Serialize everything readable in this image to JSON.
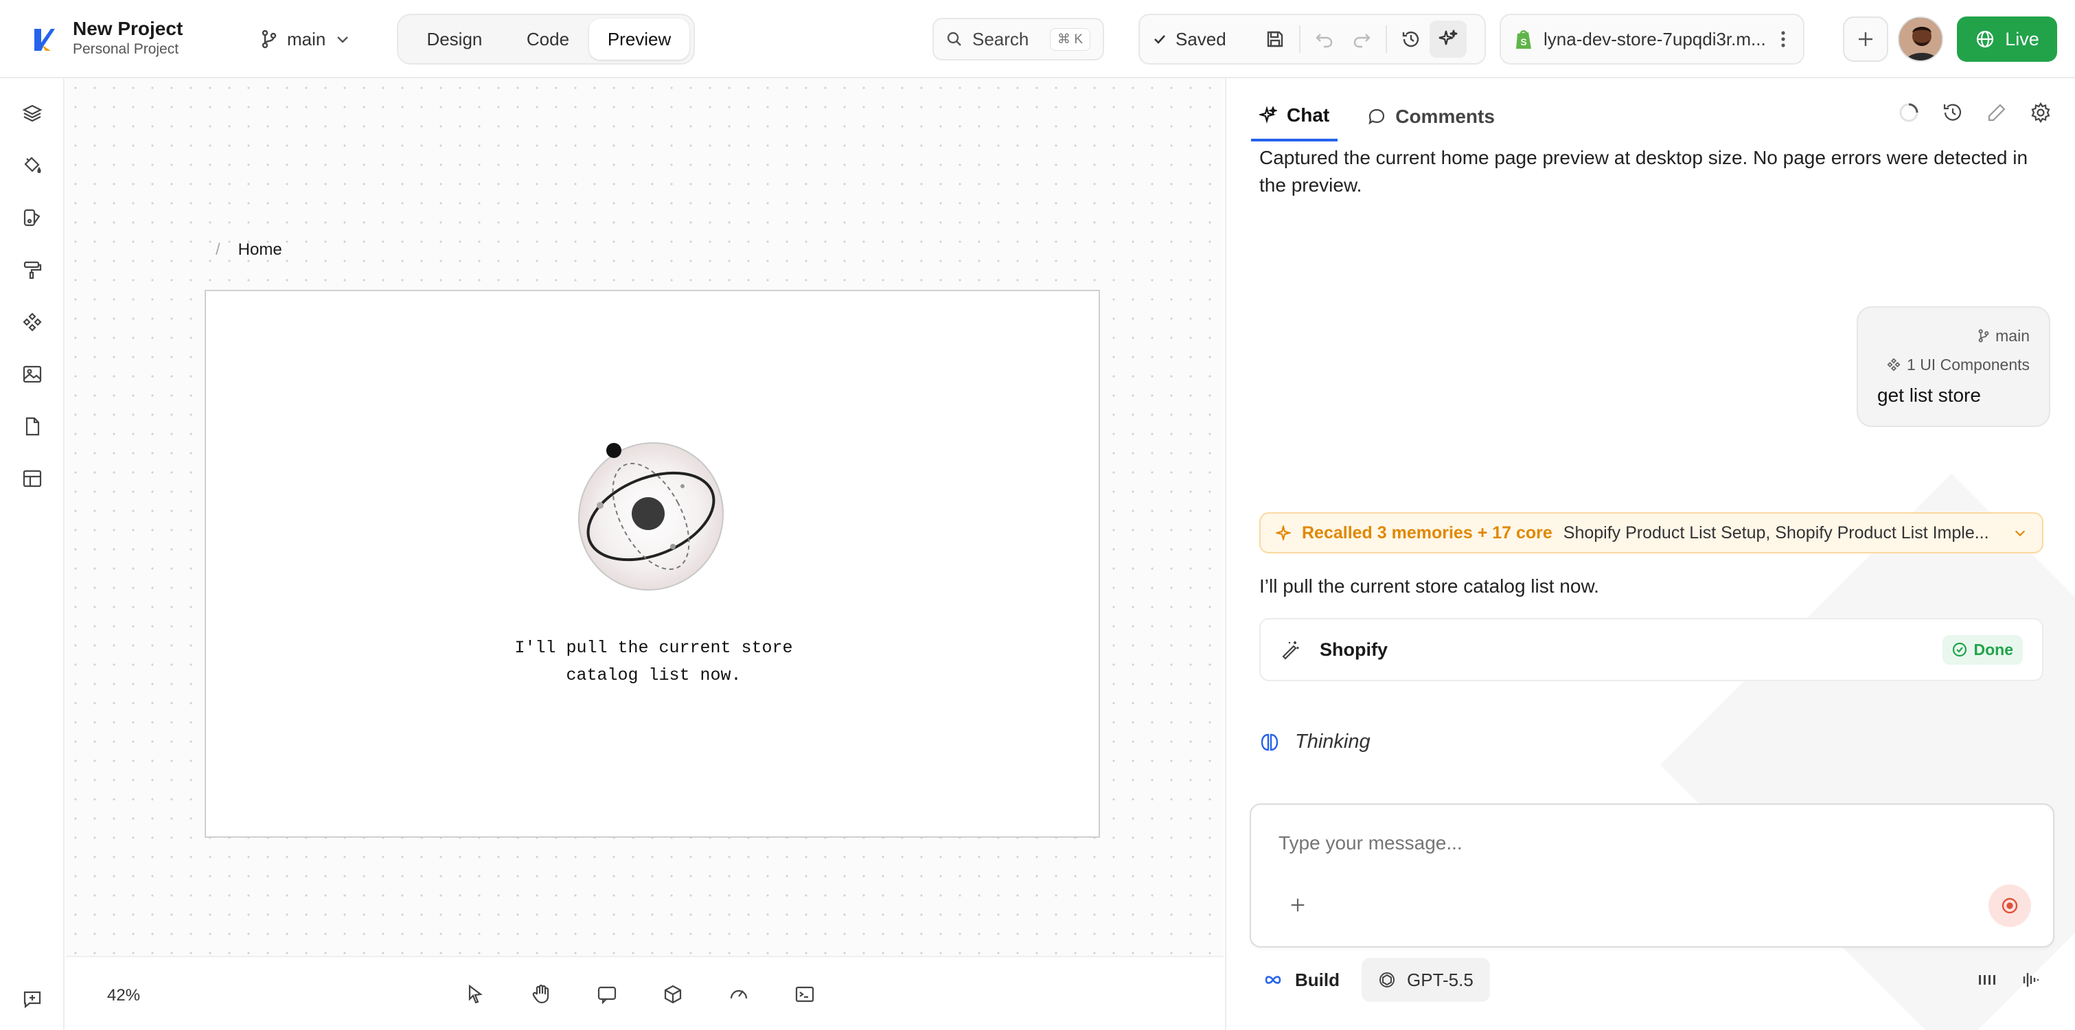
{
  "header": {
    "project_name": "New Project",
    "project_sub": "Personal Project",
    "branch": "main",
    "modes": [
      "Design",
      "Code",
      "Preview"
    ],
    "active_mode": "Preview",
    "search_label": "Search",
    "search_kbd": "⌘ K",
    "saved_label": "Saved",
    "store_name": "lyna-dev-store-7upqdi3r.m...",
    "live_label": "Live"
  },
  "colors": {
    "accent": "#2563eb",
    "live_green": "#22a34a",
    "recall_orange": "#e08800"
  },
  "rail": {
    "icons": [
      "layers-icon",
      "paint-bucket-icon",
      "palette-icon",
      "paint-roller-icon",
      "components-icon",
      "image-icon",
      "file-icon",
      "layout-icon",
      "feedback-icon"
    ]
  },
  "canvas": {
    "breadcrumb_sep": "/",
    "breadcrumb_page": "Home",
    "frame_line1": "I'll pull the current store",
    "frame_line2": "catalog list now.",
    "zoom": "42%",
    "tools": [
      "pointer-icon",
      "hand-icon",
      "comment-icon",
      "cube-icon",
      "gauge-icon",
      "terminal-icon"
    ]
  },
  "chat": {
    "tabs": [
      "Chat",
      "Comments"
    ],
    "active_tab": "Chat",
    "msg1": "Captured the current home page preview at desktop size. No page errors were detected in the preview.",
    "user_branch": "main",
    "user_components": "1 UI Components",
    "user_message": "get list store",
    "recall_lead": "Recalled 3 memories + 17 core",
    "recall_items": "Shopify Product List Setup, Shopify Product List Imple...",
    "msg2": "I’ll pull the current store catalog list now.",
    "tool_name": "Shopify",
    "tool_status": "Done",
    "thinking": "Thinking",
    "input_placeholder": "Type your message...",
    "build_label": "Build",
    "model_label": "GPT-5.5"
  }
}
